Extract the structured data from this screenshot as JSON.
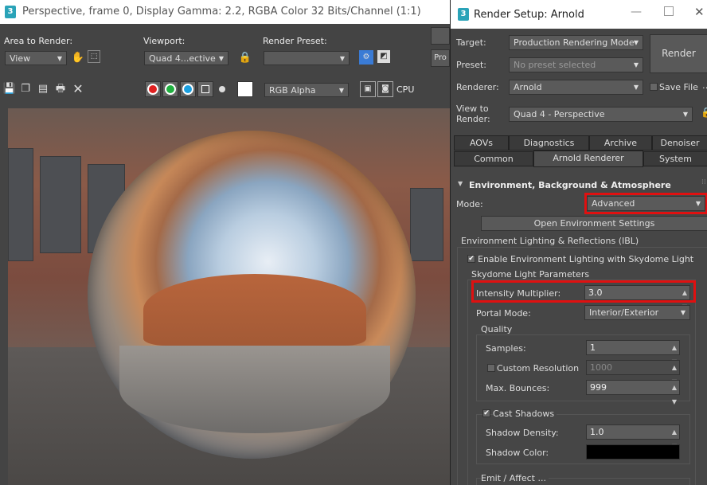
{
  "frame_window": {
    "title": "Perspective, frame 0, Display Gamma: 2.2, RGBA Color 32 Bits/Channel (1:1)",
    "area_to_render_label": "Area to Render:",
    "area_to_render_value": "View",
    "viewport_label": "Viewport:",
    "viewport_value": "Quad 4...ective",
    "render_preset_label": "Render Preset:",
    "render_preset_value": "",
    "channel_value": "RGB Alpha",
    "cpu_label": "CPU",
    "pro_label": "Pro"
  },
  "render_setup": {
    "title": "Render Setup: Arnold",
    "target_label": "Target:",
    "target_value": "Production Rendering Mode",
    "preset_label": "Preset:",
    "preset_value": "No preset selected",
    "renderer_label": "Renderer:",
    "renderer_value": "Arnold",
    "save_file_label": "Save File",
    "view_to_render_label_1": "View to",
    "view_to_render_label_2": "Render:",
    "view_to_render_value": "Quad 4 - Perspective",
    "render_button": "Render",
    "tabs_row1": [
      "AOVs",
      "Diagnostics",
      "Archive",
      "Denoiser"
    ],
    "tabs_row2": [
      "Common",
      "Arnold Renderer",
      "System"
    ],
    "section_title": "Environment, Background & Atmosphere",
    "mode_label": "Mode:",
    "mode_value": "Advanced",
    "open_env_button": "Open Environment Settings",
    "ibl_group": "Environment Lighting & Reflections (IBL)",
    "enable_env_label": "Enable Environment Lighting with Skydome Light",
    "skydome_group": "Skydome Light Parameters",
    "intensity_label": "Intensity Multiplier:",
    "intensity_value": "3.0",
    "portal_label": "Portal Mode:",
    "portal_value": "Interior/Exterior",
    "quality_group": "Quality",
    "samples_label": "Samples:",
    "samples_value": "1",
    "custom_res_label": "Custom Resolution",
    "custom_res_value": "1000",
    "max_bounces_label": "Max. Bounces:",
    "max_bounces_value": "999",
    "cast_shadows_label": "Cast Shadows",
    "shadow_density_label": "Shadow Density:",
    "shadow_density_value": "1.0",
    "shadow_color_label": "Shadow Color:",
    "emit_label": "Emit / Affect ..."
  },
  "colors": {
    "highlight": "#e01010",
    "swatch_red": "#e02020",
    "swatch_green": "#20b040",
    "swatch_blue": "#1aa0e0",
    "app_icon": "#2aa3b8"
  }
}
